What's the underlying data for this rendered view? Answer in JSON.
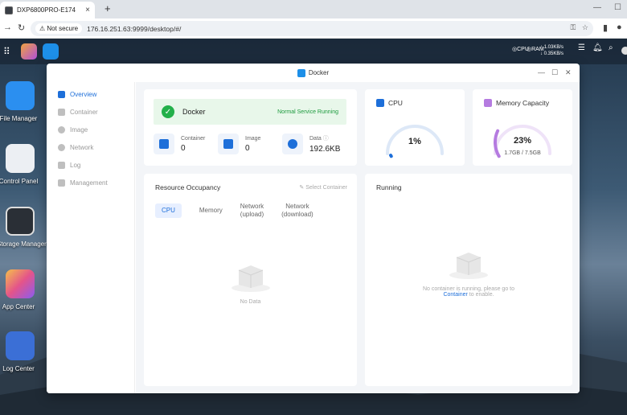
{
  "browser": {
    "tab_title": "DXP6800PRO-E174",
    "tab_close": "×",
    "new_tab": "+",
    "not_secure": "Not secure",
    "url": "176.16.251.63:9999/desktop/#/"
  },
  "topbar": {
    "net_up": "↑ 1.03KB/s",
    "net_down": "↓ 0.35KB/s",
    "cpu_lbl": "CPU",
    "ram_lbl": "RAM"
  },
  "desktop_icons": [
    {
      "label": "File Manager"
    },
    {
      "label": "Control Panel"
    },
    {
      "label": "Storage Manager"
    },
    {
      "label": "App Center"
    },
    {
      "label": "Log Center"
    }
  ],
  "window": {
    "title": "Docker"
  },
  "sidebar": {
    "items": [
      {
        "label": "Overview"
      },
      {
        "label": "Container"
      },
      {
        "label": "Image"
      },
      {
        "label": "Network"
      },
      {
        "label": "Log"
      },
      {
        "label": "Management"
      }
    ]
  },
  "status": {
    "name": "Docker",
    "text": "Normal Service Running"
  },
  "stats": [
    {
      "label": "Container",
      "value": "0"
    },
    {
      "label": "Image",
      "value": "0"
    },
    {
      "label": "Data",
      "value": "192.6KB"
    }
  ],
  "cpu": {
    "title": "CPU",
    "percent_text": "1%",
    "percent": 1
  },
  "memory": {
    "title": "Memory Capacity",
    "percent_text": "23%",
    "percent": 23,
    "detail": "1.7GB / 7.5GB"
  },
  "resource": {
    "title": "Resource Occupancy",
    "select": "Select Container",
    "tabs": [
      {
        "label": "CPU"
      },
      {
        "label": "Memory"
      },
      {
        "label": "Network\n(upload)"
      },
      {
        "label": "Network\n(download)"
      }
    ],
    "nodata": "No Data"
  },
  "running": {
    "title": "Running",
    "empty_prefix": "No container is running, please go to",
    "empty_link": "Container",
    "empty_suffix": "to enable."
  },
  "colors": {
    "accent": "#1e6fd9",
    "success": "#23b04a",
    "memory_arc": "#b57be0"
  }
}
